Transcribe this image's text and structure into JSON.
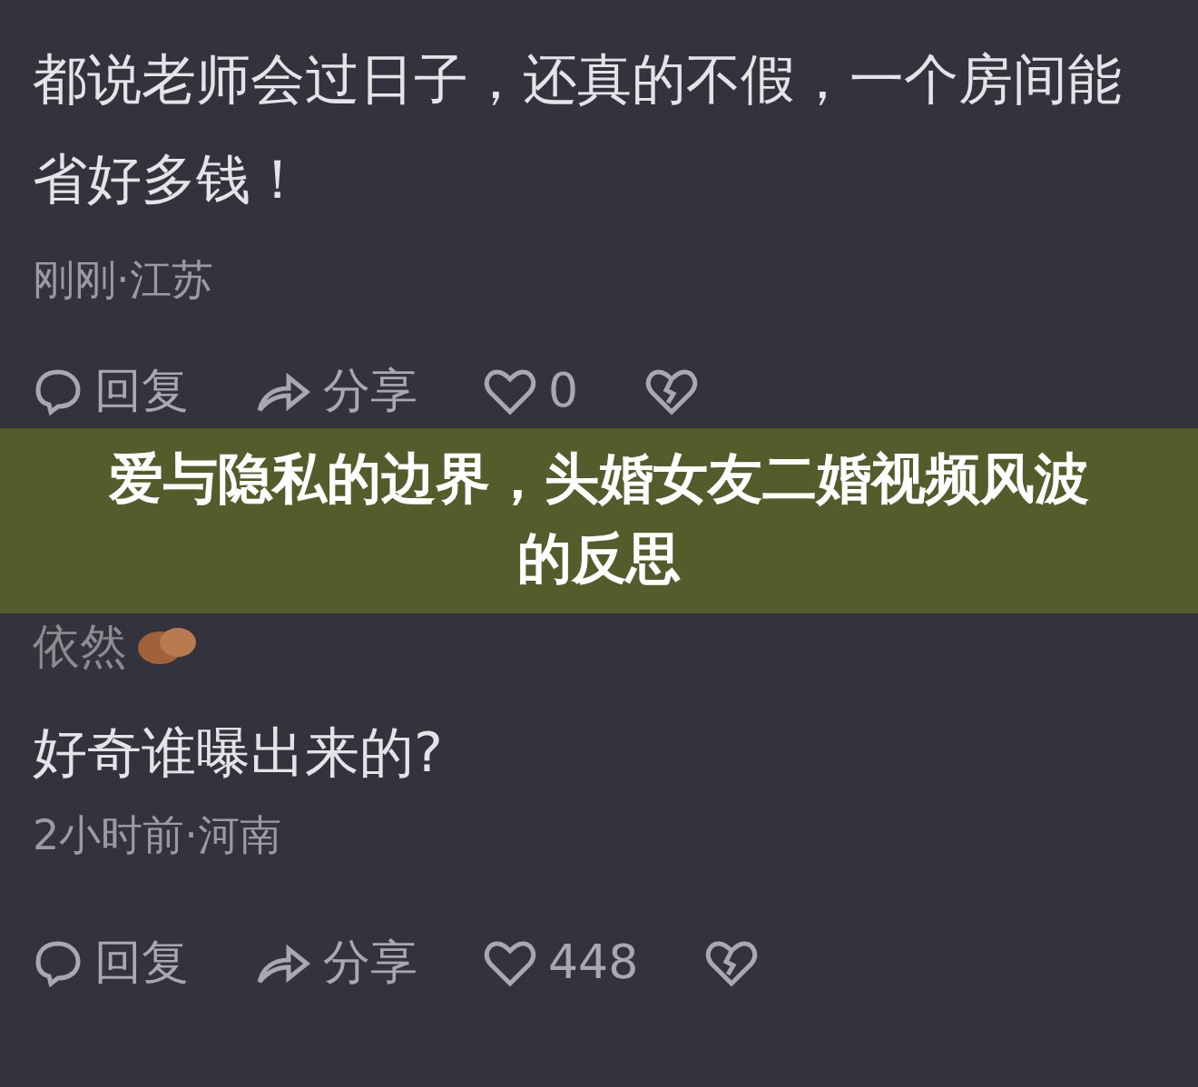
{
  "comments": [
    {
      "text": "都说老师会过日子，还真的不假，一个房间能省好多钱！",
      "meta": "刚刚·江苏",
      "reply": "回复",
      "share": "分享",
      "likes": "0"
    },
    {
      "username": "依然",
      "text": "好奇谁曝出来的?",
      "meta": "2小时前·河南",
      "reply": "回复",
      "share": "分享",
      "likes": "448"
    }
  ],
  "banner": {
    "title": "爱与隐私的边界，头婚女友二婚视频风波的反思"
  }
}
